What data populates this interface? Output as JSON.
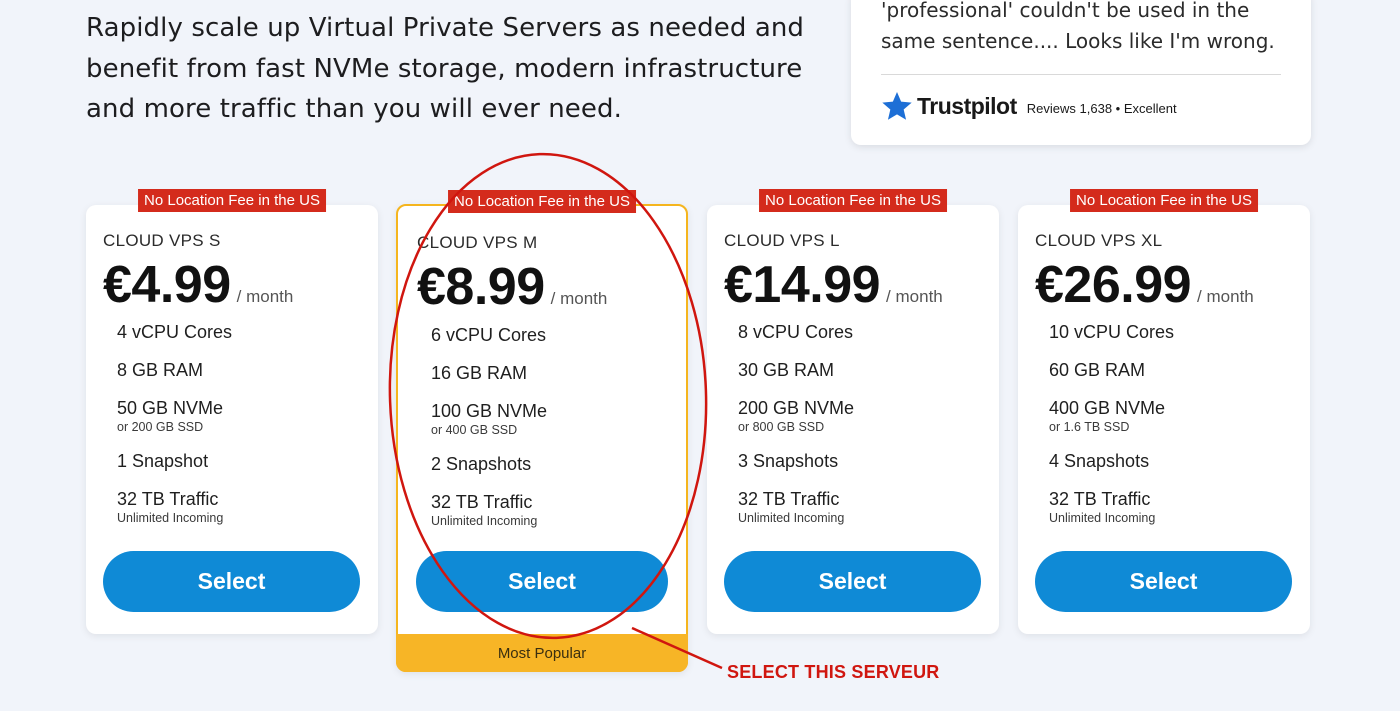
{
  "hero": {
    "description": "Rapidly scale up Virtual Private Servers as needed and benefit from fast NVMe storage, modern infrastructure and more traffic than you will ever need."
  },
  "review": {
    "quote": "'professional' couldn't be used in the same sentence.... Looks like I'm wrong.",
    "trustpilot_name": "Trustpilot",
    "trustpilot_meta": "Reviews 1,638 • Excellent"
  },
  "plans": [
    {
      "badge": "No Location Fee in the US",
      "name": "CLOUD VPS S",
      "price": "€4.99",
      "period": "/ month",
      "features": [
        {
          "main": "4 vCPU Cores",
          "sub": ""
        },
        {
          "main": "8 GB RAM",
          "sub": ""
        },
        {
          "main": "50 GB NVMe",
          "sub": "or 200 GB SSD"
        },
        {
          "main": "1 Snapshot",
          "sub": ""
        },
        {
          "main": "32 TB Traffic",
          "sub": "Unlimited Incoming"
        }
      ],
      "button": "Select"
    },
    {
      "badge": "No Location Fee in the US",
      "name": "CLOUD VPS M",
      "price": "€8.99",
      "period": "/ month",
      "features": [
        {
          "main": "6 vCPU Cores",
          "sub": ""
        },
        {
          "main": "16 GB RAM",
          "sub": ""
        },
        {
          "main": "100 GB NVMe",
          "sub": "or 400 GB SSD"
        },
        {
          "main": "2 Snapshots",
          "sub": ""
        },
        {
          "main": "32 TB Traffic",
          "sub": "Unlimited Incoming"
        }
      ],
      "button": "Select",
      "footer": "Most Popular"
    },
    {
      "badge": "No Location Fee in the US",
      "name": "CLOUD VPS L",
      "price": "€14.99",
      "period": "/ month",
      "features": [
        {
          "main": "8 vCPU Cores",
          "sub": ""
        },
        {
          "main": "30 GB RAM",
          "sub": ""
        },
        {
          "main": "200 GB NVMe",
          "sub": "or 800 GB SSD"
        },
        {
          "main": "3 Snapshots",
          "sub": ""
        },
        {
          "main": "32 TB Traffic",
          "sub": "Unlimited Incoming"
        }
      ],
      "button": "Select"
    },
    {
      "badge": "No Location Fee in the US",
      "name": "CLOUD VPS XL",
      "price": "€26.99",
      "period": "/ month",
      "features": [
        {
          "main": "10 vCPU Cores",
          "sub": ""
        },
        {
          "main": "60 GB RAM",
          "sub": ""
        },
        {
          "main": "400 GB NVMe",
          "sub": "or 1.6 TB SSD"
        },
        {
          "main": "4 Snapshots",
          "sub": ""
        },
        {
          "main": "32 TB Traffic",
          "sub": "Unlimited Incoming"
        }
      ],
      "button": "Select"
    }
  ],
  "annotation": {
    "text": "SELECT THIS SERVEUR",
    "color": "#d0160f"
  },
  "colors": {
    "accent": "#0f8ad6",
    "badge": "#d42b1c",
    "popular": "#f7b526",
    "trustpilot_star": "#00b67a"
  }
}
